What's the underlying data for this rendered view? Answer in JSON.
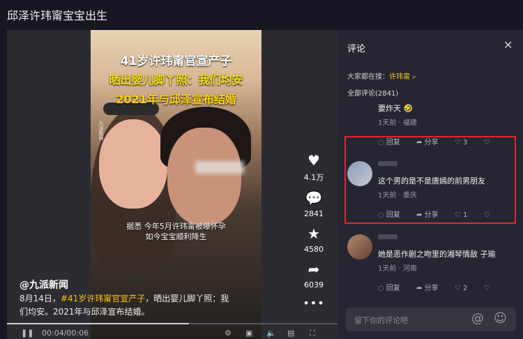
{
  "page": {
    "title": "邱泽许玮甯宝宝出生"
  },
  "video": {
    "headline": [
      "41岁许玮甯官宣产子",
      "晒出婴儿脚丫照：我们均安",
      "2021年与邱泽宣布结婚"
    ],
    "watermark": "九派新闻",
    "subtitle": [
      "据悉 今年5月许玮甯被曝怀孕",
      "如今宝宝顺利降生"
    ],
    "author": "@九派新闻",
    "description": {
      "prefix": "8月14日，",
      "tag": "#41岁许玮甯官宣产子",
      "suffix": "，晒出婴儿脚丫照：我们均安。2021年与邱泽宣布结婚。"
    },
    "actions": {
      "like_count": "4.1万",
      "comment_count": "2841",
      "favorite_count": "4580",
      "share_count": "6039"
    },
    "time": "00:04/00:06",
    "progress": 0.55
  },
  "comments_panel": {
    "title": "评论",
    "search_prefix": "大家都在搜：",
    "search_term": "许玮甯",
    "count_label": "全部评论(2841)",
    "input_placeholder": "留下你的评论吧",
    "comments": [
      {
        "text": "要炸天 🤣",
        "time": "1天前",
        "location": "福建",
        "reply": "回复",
        "share": "分享",
        "likes": "3"
      },
      {
        "text": "这个男的是不是唐嫣的前男朋友",
        "time": "1天前",
        "location": "重庆",
        "reply": "回复",
        "share": "分享",
        "likes": "1"
      },
      {
        "text": "她是恶作剧之吻里的湘琴情敌 子瑜",
        "time": "1天前",
        "location": "河南",
        "reply": "回复",
        "share": "分享",
        "likes": "2"
      }
    ]
  },
  "colors": {
    "accent_yellow": "#f5c518",
    "highlight_red": "#e3262f",
    "panel_bg": "#252632"
  }
}
